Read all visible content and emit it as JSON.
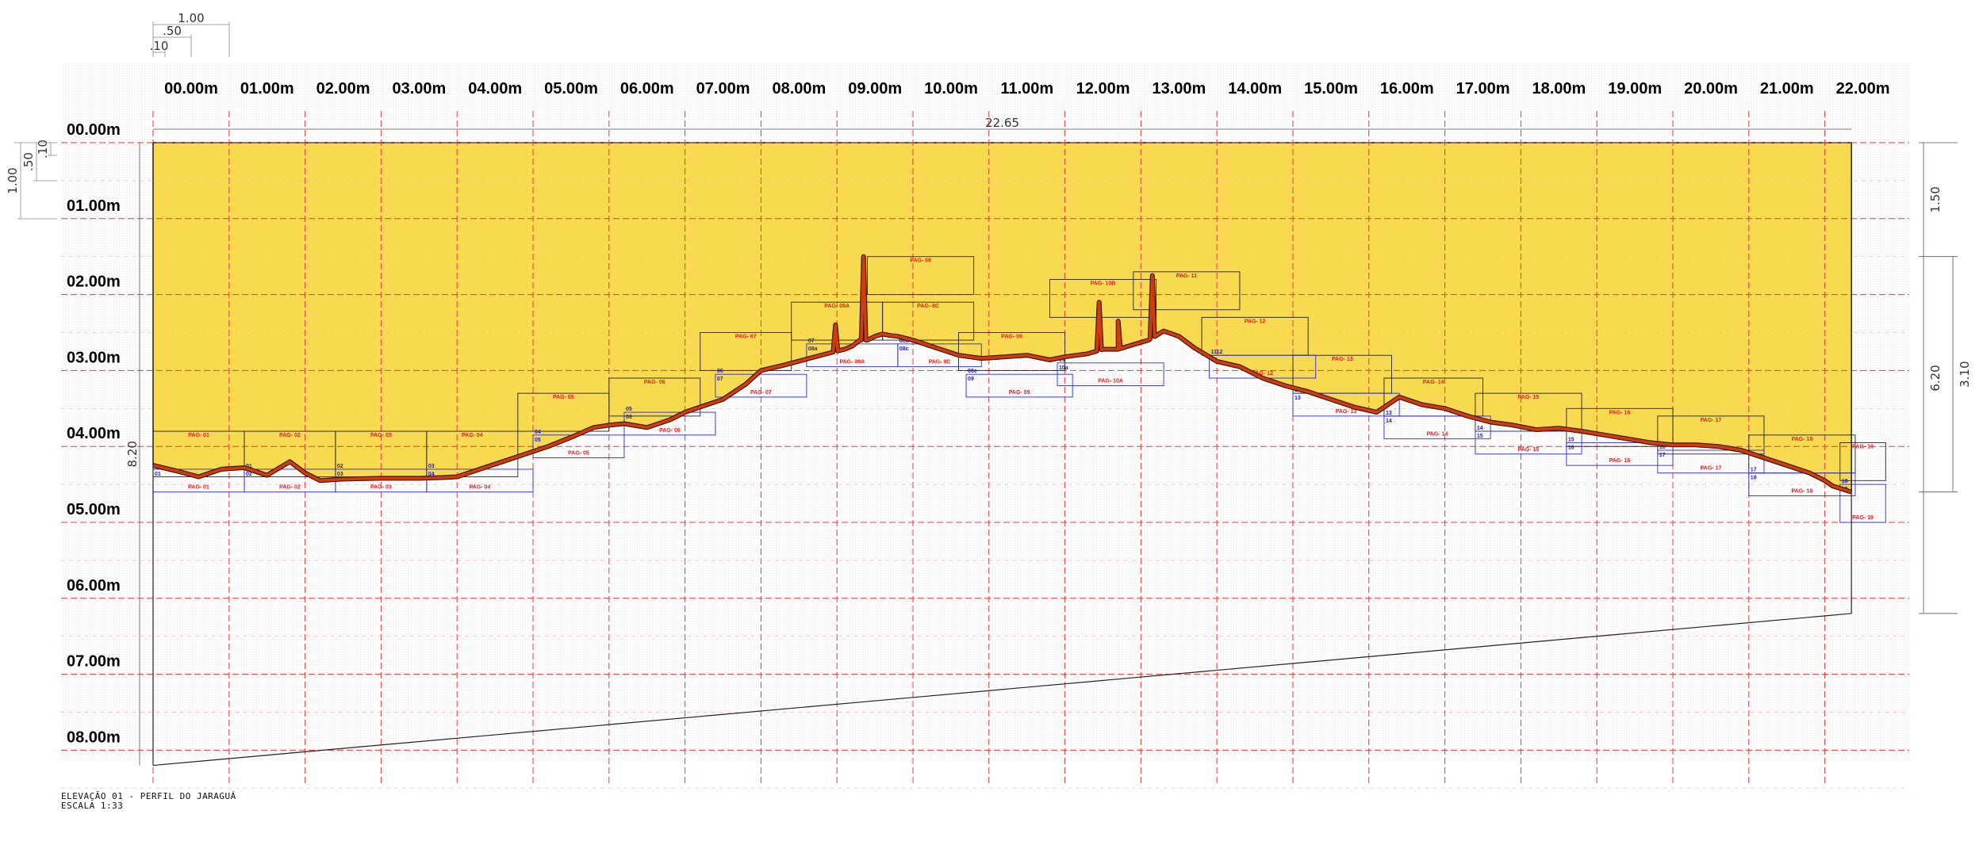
{
  "drawing": {
    "x_labels": [
      "00.00m",
      "01.00m",
      "02.00m",
      "03.00m",
      "04.00m",
      "05.00m",
      "06.00m",
      "07.00m",
      "08.00m",
      "09.00m",
      "10.00m",
      "11.00m",
      "12.00m",
      "13.00m",
      "14.00m",
      "15.00m",
      "16.00m",
      "17.00m",
      "18.00m",
      "19.00m",
      "20.00m",
      "21.00m",
      "22.00m"
    ],
    "y_labels": [
      "00.00m",
      "01.00m",
      "02.00m",
      "03.00m",
      "04.00m",
      "05.00m",
      "06.00m",
      "07.00m",
      "08.00m"
    ],
    "dimensions": {
      "total_width": "22.65",
      "left_height": "8.20",
      "right_top": "1.50",
      "right_mid": "3.10",
      "right_total": "6.20",
      "scale_bar_h": [
        "1.00",
        ".50",
        ".10"
      ],
      "scale_bar_v": [
        "1.00",
        ".50",
        ".10"
      ]
    },
    "caption": {
      "title": "ELEVAÇÃO 01 - PERFIL DO JARAGUÁ",
      "scale": "ESCALA 1:33"
    },
    "colors": {
      "fill": "#f8dc57",
      "profile": "#d23b0c",
      "grid": "#e23c3c",
      "page_box_black": "#222222",
      "page_box_blue": "#2a2adc"
    },
    "profile_x": [
      0,
      0.3,
      0.6,
      0.9,
      1.2,
      1.5,
      1.8,
      2.0,
      2.2,
      2.5,
      3.0,
      3.5,
      3.8,
      4.0,
      4.3,
      4.6,
      4.9,
      5.2,
      5.5,
      5.8,
      6.0,
      6.2,
      6.5,
      6.8,
      7.0,
      7.2,
      7.5,
      7.8,
      8.0,
      8.3,
      8.6,
      8.9,
      9.1,
      9.2,
      9.3,
      9.4,
      9.5,
      9.6,
      9.7,
      9.8,
      10.0,
      10.3,
      10.6,
      10.9,
      11.2,
      11.5,
      11.8,
      12.0,
      12.3,
      12.5,
      12.7,
      12.9,
      13.1,
      13.3,
      13.5,
      13.7,
      14.0,
      14.3,
      14.6,
      14.9,
      15.2,
      15.5,
      15.8,
      16.1,
      16.4,
      16.7,
      17.0,
      17.3,
      17.6,
      17.9,
      18.2,
      18.5,
      18.8,
      19.1,
      19.4,
      19.7,
      20.0,
      20.3,
      20.6,
      20.9,
      21.2,
      21.5,
      21.8,
      22.0,
      22.1,
      22.35
    ],
    "profile_y": [
      4.25,
      4.32,
      4.4,
      4.3,
      4.28,
      4.38,
      4.2,
      4.35,
      4.45,
      4.43,
      4.42,
      4.42,
      4.41,
      4.4,
      4.3,
      4.2,
      4.1,
      4.0,
      3.88,
      3.75,
      3.72,
      3.7,
      3.75,
      3.65,
      3.55,
      3.48,
      3.38,
      3.18,
      3.0,
      2.93,
      2.85,
      2.77,
      2.72,
      2.68,
      2.6,
      2.6,
      2.55,
      2.52,
      2.54,
      2.55,
      2.6,
      2.7,
      2.8,
      2.84,
      2.82,
      2.8,
      2.86,
      2.82,
      2.78,
      2.72,
      2.72,
      2.66,
      2.6,
      2.48,
      2.55,
      2.7,
      2.88,
      2.95,
      3.1,
      3.2,
      3.28,
      3.38,
      3.48,
      3.55,
      3.35,
      3.45,
      3.5,
      3.6,
      3.68,
      3.72,
      3.78,
      3.76,
      3.8,
      3.85,
      3.9,
      3.95,
      3.98,
      3.98,
      4.0,
      4.05,
      4.15,
      4.25,
      4.35,
      4.45,
      4.52,
      4.6
    ],
    "profile_spikes": [
      {
        "x": 9.35,
        "y": 1.5
      },
      {
        "x": 12.45,
        "y": 2.1
      },
      {
        "x": 13.15,
        "y": 1.75
      },
      {
        "x": 8.98,
        "y": 2.4
      },
      {
        "x": 12.7,
        "y": 2.35
      }
    ],
    "pages_red": [
      {
        "id": "PAG- 01",
        "x0": 0.0,
        "x1": 1.2,
        "y0": 3.8,
        "y1": 4.4
      },
      {
        "id": "PAG- 02",
        "x0": 1.2,
        "x1": 2.4,
        "y0": 3.8,
        "y1": 4.4
      },
      {
        "id": "PAG- 03",
        "x0": 2.4,
        "x1": 3.6,
        "y0": 3.8,
        "y1": 4.4
      },
      {
        "id": "PAG- 04",
        "x0": 3.6,
        "x1": 4.8,
        "y0": 3.8,
        "y1": 4.4
      },
      {
        "id": "PAG- 05",
        "x0": 4.8,
        "x1": 6.0,
        "y0": 3.3,
        "y1": 3.8
      },
      {
        "id": "PAG- 06",
        "x0": 6.0,
        "x1": 7.2,
        "y0": 3.1,
        "y1": 3.6
      },
      {
        "id": "PAG- 07",
        "x0": 7.2,
        "x1": 8.4,
        "y0": 2.5,
        "y1": 3.0
      },
      {
        "id": "PAG- 08A",
        "x0": 8.4,
        "x1": 9.6,
        "y0": 2.1,
        "y1": 2.6
      },
      {
        "id": "PAG- 08",
        "x0": 9.4,
        "x1": 10.8,
        "y0": 1.5,
        "y1": 2.0
      },
      {
        "id": "PAG- 8C",
        "x0": 9.6,
        "x1": 10.8,
        "y0": 2.1,
        "y1": 2.6
      },
      {
        "id": "PAG- 09",
        "x0": 10.6,
        "x1": 12.0,
        "y0": 2.5,
        "y1": 3.0
      },
      {
        "id": "PAG- 10B",
        "x0": 11.8,
        "x1": 13.2,
        "y0": 1.8,
        "y1": 2.3
      },
      {
        "id": "PAG- 11",
        "x0": 12.9,
        "x1": 14.3,
        "y0": 1.7,
        "y1": 2.2
      },
      {
        "id": "PAG- 12",
        "x0": 13.8,
        "x1": 15.2,
        "y0": 2.3,
        "y1": 2.8
      },
      {
        "id": "PAG- 13",
        "x0": 15.0,
        "x1": 16.3,
        "y0": 2.8,
        "y1": 3.3
      },
      {
        "id": "PAG- 14",
        "x0": 16.2,
        "x1": 17.5,
        "y0": 3.1,
        "y1": 3.6
      },
      {
        "id": "PAG- 15",
        "x0": 17.4,
        "x1": 18.8,
        "y0": 3.3,
        "y1": 3.8
      },
      {
        "id": "PAG- 16",
        "x0": 18.6,
        "x1": 20.0,
        "y0": 3.5,
        "y1": 4.0
      },
      {
        "id": "PAG- 17",
        "x0": 19.8,
        "x1": 21.2,
        "y0": 3.6,
        "y1": 4.1
      },
      {
        "id": "PAG- 18",
        "x0": 21.0,
        "x1": 22.4,
        "y0": 3.85,
        "y1": 4.35
      },
      {
        "id": "PAG- 19",
        "x0": 22.2,
        "x1": 22.8,
        "y0": 3.95,
        "y1": 4.45
      }
    ],
    "pages_blue": [
      {
        "id": "PAG- 01",
        "x0": 0.0,
        "x1": 1.2,
        "y0": 4.3,
        "y1": 4.6,
        "a": "01",
        "b": ""
      },
      {
        "id": "PAG- 02",
        "x0": 1.2,
        "x1": 2.4,
        "y0": 4.3,
        "y1": 4.6,
        "a": "02",
        "b": "01"
      },
      {
        "id": "PAG- 03",
        "x0": 2.4,
        "x1": 3.6,
        "y0": 4.3,
        "y1": 4.6,
        "a": "03",
        "b": "02"
      },
      {
        "id": "PAG- 04",
        "x0": 3.6,
        "x1": 5.0,
        "y0": 4.3,
        "y1": 4.6,
        "a": "04",
        "b": "03"
      },
      {
        "id": "PAG- 05",
        "x0": 5.0,
        "x1": 6.2,
        "y0": 3.85,
        "y1": 4.15,
        "a": "05",
        "b": "04"
      },
      {
        "id": "PAG- 06",
        "x0": 6.2,
        "x1": 7.4,
        "y0": 3.55,
        "y1": 3.85,
        "a": "06",
        "b": "05"
      },
      {
        "id": "PAG- 07",
        "x0": 7.4,
        "x1": 8.6,
        "y0": 3.05,
        "y1": 3.35,
        "a": "07",
        "b": "06"
      },
      {
        "id": "PAG- 08A",
        "x0": 8.6,
        "x1": 9.8,
        "y0": 2.65,
        "y1": 2.95,
        "a": "08a",
        "b": "07"
      },
      {
        "id": "PAG- 8C",
        "x0": 9.8,
        "x1": 10.9,
        "y0": 2.65,
        "y1": 2.95,
        "a": "08c",
        "b": "08a"
      },
      {
        "id": "PAG- 09",
        "x0": 10.7,
        "x1": 12.1,
        "y0": 3.05,
        "y1": 3.35,
        "a": "09",
        "b": "08c"
      },
      {
        "id": "PAG- 10A",
        "x0": 11.9,
        "x1": 13.3,
        "y0": 2.9,
        "y1": 3.2,
        "a": "10a",
        "b": "09"
      },
      {
        "id": "PAG- 12",
        "x0": 13.9,
        "x1": 15.3,
        "y0": 2.8,
        "y1": 3.1,
        "a": "12",
        "b": "1112"
      },
      {
        "id": "PAG- 13",
        "x0": 15.0,
        "x1": 16.4,
        "y0": 3.3,
        "y1": 3.6,
        "a": "13",
        "b": "12"
      },
      {
        "id": "PAG- 14",
        "x0": 16.2,
        "x1": 17.6,
        "y0": 3.6,
        "y1": 3.9,
        "a": "14",
        "b": "13"
      },
      {
        "id": "PAG- 15",
        "x0": 17.4,
        "x1": 18.8,
        "y0": 3.8,
        "y1": 4.1,
        "a": "15",
        "b": "14"
      },
      {
        "id": "PAG- 16",
        "x0": 18.6,
        "x1": 20.0,
        "y0": 3.95,
        "y1": 4.25,
        "a": "16",
        "b": "15"
      },
      {
        "id": "PAG- 17",
        "x0": 19.8,
        "x1": 21.2,
        "y0": 4.05,
        "y1": 4.35,
        "a": "17",
        "b": "16"
      },
      {
        "id": "PAG- 18",
        "x0": 21.0,
        "x1": 22.4,
        "y0": 4.35,
        "y1": 4.65,
        "a": "18",
        "b": "17"
      },
      {
        "id": "PAG- 19",
        "x0": 22.2,
        "x1": 22.8,
        "y0": 4.5,
        "y1": 5.0,
        "a": "19",
        "b": "18"
      }
    ]
  }
}
